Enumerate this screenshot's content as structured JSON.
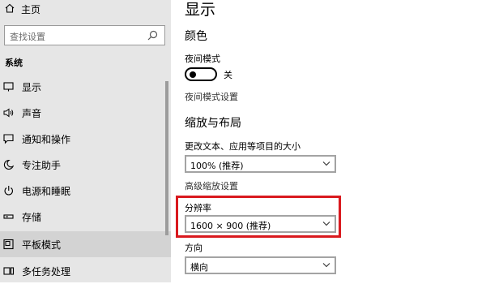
{
  "sidebar": {
    "home_label": "主页",
    "search_placeholder": "查找设置",
    "section_label": "系统",
    "items": [
      {
        "label": "显示",
        "icon": "monitor-icon"
      },
      {
        "label": "声音",
        "icon": "speaker-icon"
      },
      {
        "label": "通知和操作",
        "icon": "notification-icon"
      },
      {
        "label": "专注助手",
        "icon": "moon-icon"
      },
      {
        "label": "电源和睡眠",
        "icon": "power-icon"
      },
      {
        "label": "存储",
        "icon": "storage-icon"
      },
      {
        "label": "平板模式",
        "icon": "tablet-icon"
      },
      {
        "label": "多任务处理",
        "icon": "multitask-icon"
      }
    ]
  },
  "main": {
    "title": "显示",
    "color_heading": "颜色",
    "night_mode_label": "夜间模式",
    "night_mode_state": "关",
    "night_mode_settings_link": "夜间模式设置",
    "scale_heading": "缩放与布局",
    "size_label": "更改文本、应用等项目的大小",
    "size_value": "100% (推荐)",
    "advanced_scaling_link": "高级缩放设置",
    "resolution_label": "分辨率",
    "resolution_value": "1600 × 900 (推荐)",
    "orientation_label": "方向",
    "orientation_value": "横向"
  },
  "colors": {
    "sidebar_bg": "#e6e6e6",
    "active_item_bg": "#d3d3d3",
    "highlight_border": "#d9191e"
  }
}
